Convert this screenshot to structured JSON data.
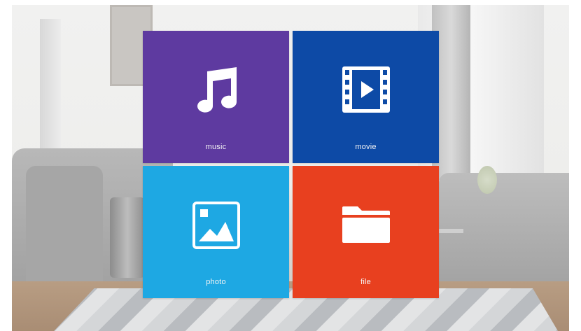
{
  "menu": {
    "tiles": [
      {
        "label": "music",
        "color": "#5e3aa0",
        "icon": "music-note-icon"
      },
      {
        "label": "movie",
        "color": "#0d4aa6",
        "icon": "film-play-icon"
      },
      {
        "label": "photo",
        "color": "#1ea8e3",
        "icon": "image-icon"
      },
      {
        "label": "file",
        "color": "#e8401f",
        "icon": "folder-icon"
      }
    ]
  }
}
